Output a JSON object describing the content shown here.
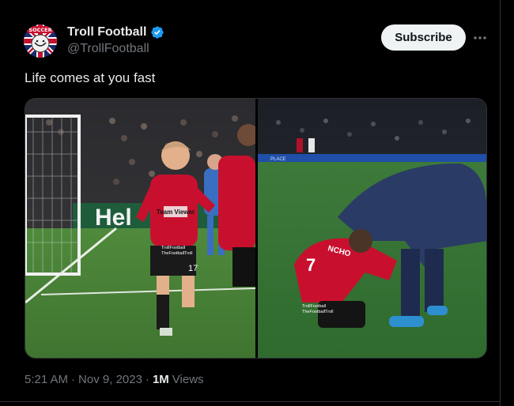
{
  "author": {
    "display_name": "Troll Football",
    "handle": "@TrollFootball",
    "verified": true,
    "avatar_label": "SOCCER"
  },
  "actions": {
    "subscribe_label": "Subscribe",
    "more_icon": "more-horizontal-icon"
  },
  "tweet": {
    "text": "Life comes at you fast"
  },
  "media": {
    "left_image": {
      "ad_board_text": "Hel",
      "shirt_sponsor": "Team Viewer",
      "shirt_number": "17",
      "watermark_1": "TrollFootball",
      "watermark_2": "TheFootballTroll"
    },
    "right_image": {
      "shirt_name": "NCHO",
      "shirt_number": "7",
      "board_text": "PLACE",
      "watermark_1": "TrollFootball",
      "watermark_2": "TheFootballTroll"
    }
  },
  "meta": {
    "time": "5:21 AM",
    "sep1": "·",
    "date": "Nov 9, 2023",
    "sep2": "·",
    "views_count": "1M",
    "views_label": "Views"
  },
  "colors": {
    "background": "#000000",
    "text_primary": "#e7e9ea",
    "text_secondary": "#71767b",
    "verified_blue": "#1d9bf0",
    "subscribe_bg": "#eff3f4",
    "united_red": "#c8102e"
  }
}
